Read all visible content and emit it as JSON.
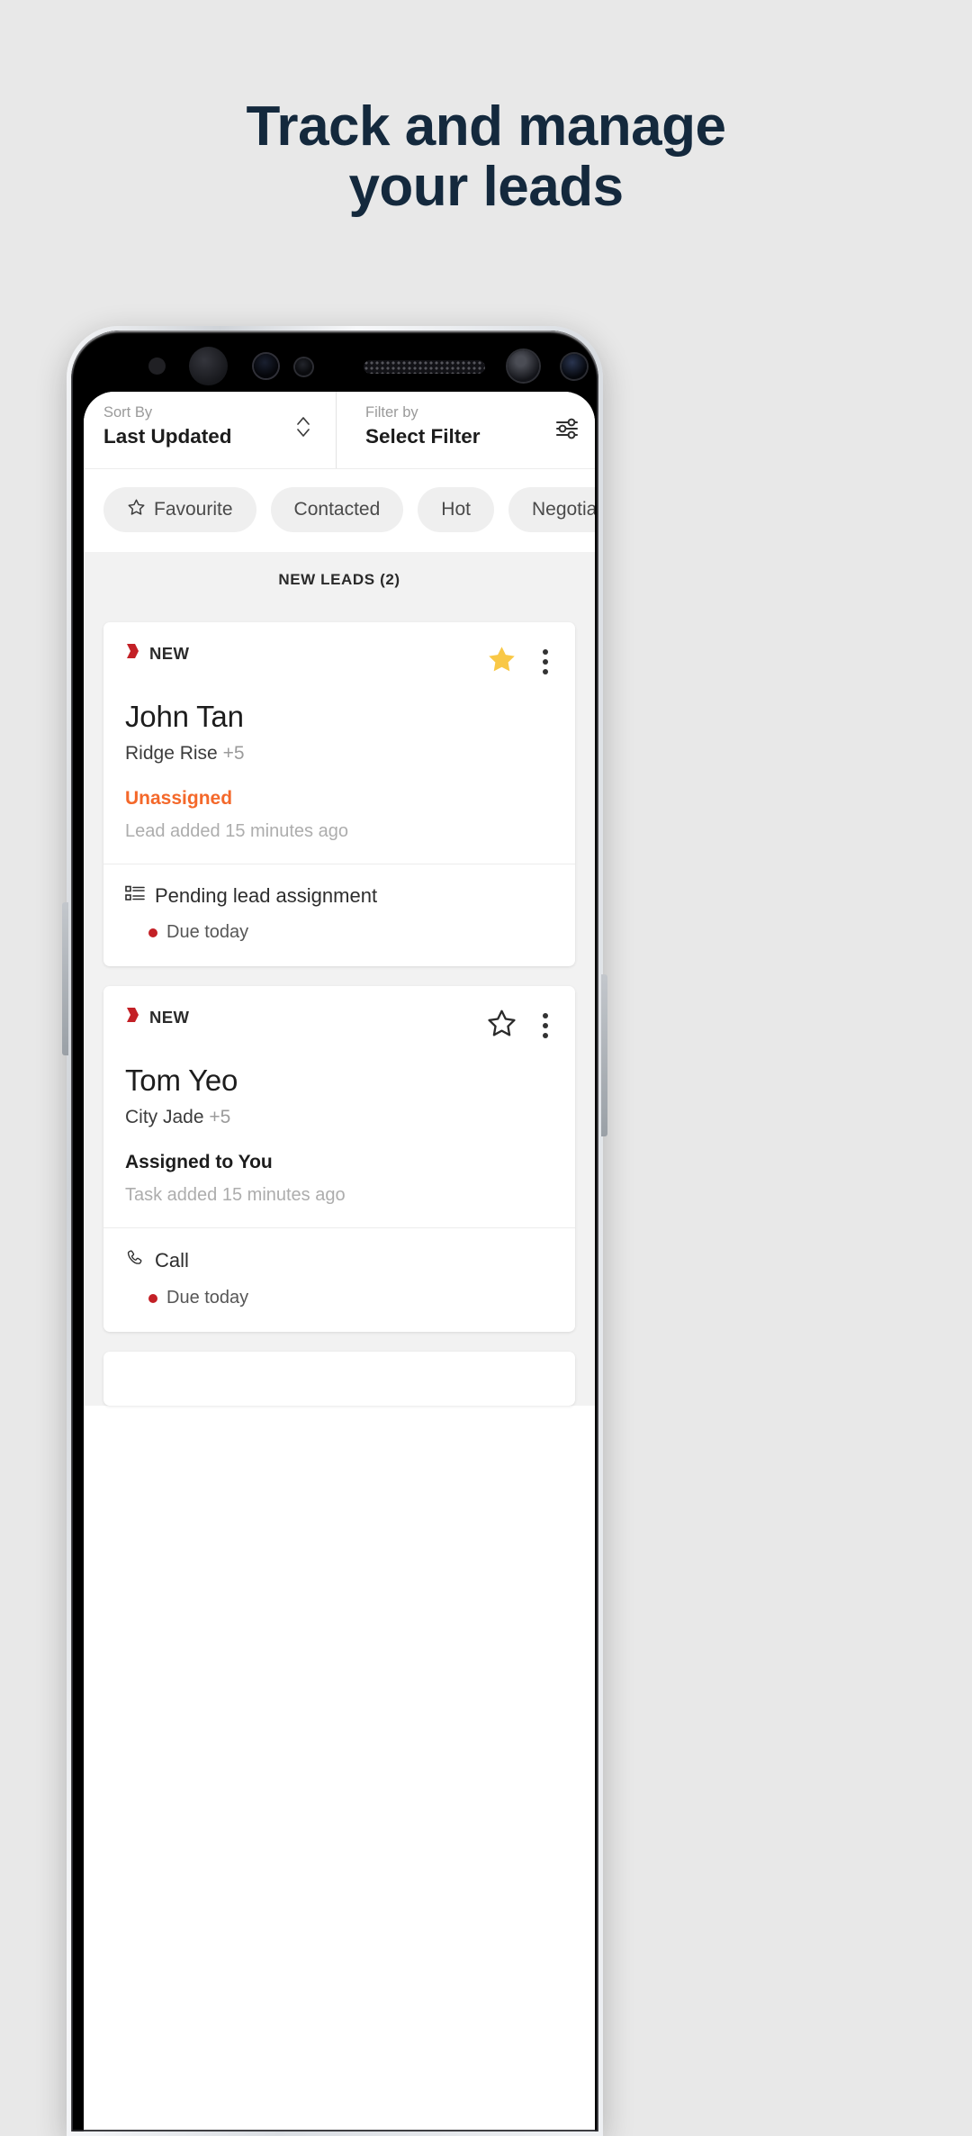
{
  "headline": {
    "line1": "Track and manage",
    "line2": "your leads",
    "color": "#14293d"
  },
  "screen": {
    "sort": {
      "label": "Sort By",
      "value": "Last Updated",
      "icon": "chevron-up-down-icon"
    },
    "filter": {
      "label": "Filter by",
      "value": "Select Filter",
      "icon": "tune-sliders-icon"
    },
    "chips": [
      {
        "label": "Favourite",
        "icon": "star-outline-icon"
      },
      {
        "label": "Contacted",
        "icon": null
      },
      {
        "label": "Hot",
        "icon": null
      },
      {
        "label": "Negotia",
        "icon": null
      }
    ],
    "section_header": "NEW LEADS (2)",
    "cards": [
      {
        "badge": "NEW",
        "badge_icon": "red-flag-icon",
        "favourite": true,
        "favourite_icon": "star-filled-icon",
        "menu_icon": "kebab-menu-icon",
        "name": "John Tan",
        "project": "Ridge Rise",
        "project_extra": "+5",
        "status": "Unassigned",
        "status_color": "#f4682a",
        "subtitle": "Lead added 15 minutes ago",
        "task": {
          "icon": "list-assignment-icon",
          "title": "Pending lead assignment",
          "due": "Due today",
          "due_dot_color": "#c32026"
        }
      },
      {
        "badge": "NEW",
        "badge_icon": "red-flag-icon",
        "favourite": false,
        "favourite_icon": "star-outline-icon",
        "menu_icon": "kebab-menu-icon",
        "name": "Tom Yeo",
        "project": "City Jade",
        "project_extra": "+5",
        "status": "Assigned to You",
        "status_color": "#1d1d1d",
        "subtitle": "Task added 15 minutes ago",
        "task": {
          "icon": "phone-call-icon",
          "title": "Call",
          "due": "Due today",
          "due_dot_color": "#c32026"
        }
      }
    ]
  }
}
